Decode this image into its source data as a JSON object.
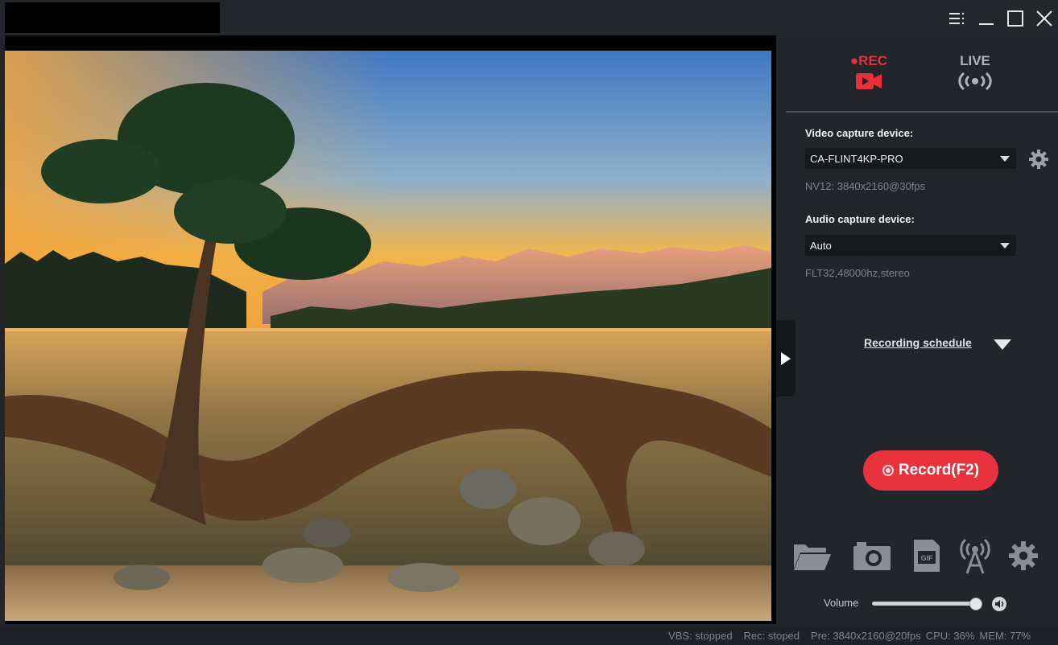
{
  "mode_tabs": {
    "rec_label": "●REC",
    "live_label": "LIVE"
  },
  "video": {
    "label": "Video capture device:",
    "device": "CA-FLINT4KP-PRO",
    "format": "NV12: 3840x2160@30fps"
  },
  "audio": {
    "label": "Audio capture device:",
    "device": "Auto",
    "format": "FLT32,48000hz,stereo"
  },
  "schedule": {
    "label": "Recording schedule"
  },
  "record_button": {
    "label": "Record(F2)"
  },
  "volume": {
    "label": "Volume",
    "level": 1.0
  },
  "status": {
    "vbs": "VBS: stopped",
    "rec": "Rec: stoped",
    "pre": "Pre: 3840x2160@20fps",
    "cpu": "CPU: 36%",
    "mem": "MEM: 77%"
  },
  "icons": {
    "menu": "menu-icon",
    "minimize": "minimize-icon",
    "maximize": "maximize-icon",
    "close": "close-icon",
    "expand": "play-right-icon",
    "settings_device": "gear-icon",
    "folder": "folder-icon",
    "snapshot": "camera-icon",
    "gif": "gif-icon",
    "broadcast": "antenna-icon",
    "settings": "gear-icon",
    "speaker": "speaker-icon"
  },
  "colors": {
    "accent": "#e8333f",
    "panel_bg": "#22262b",
    "muted_text": "#7d838a"
  }
}
